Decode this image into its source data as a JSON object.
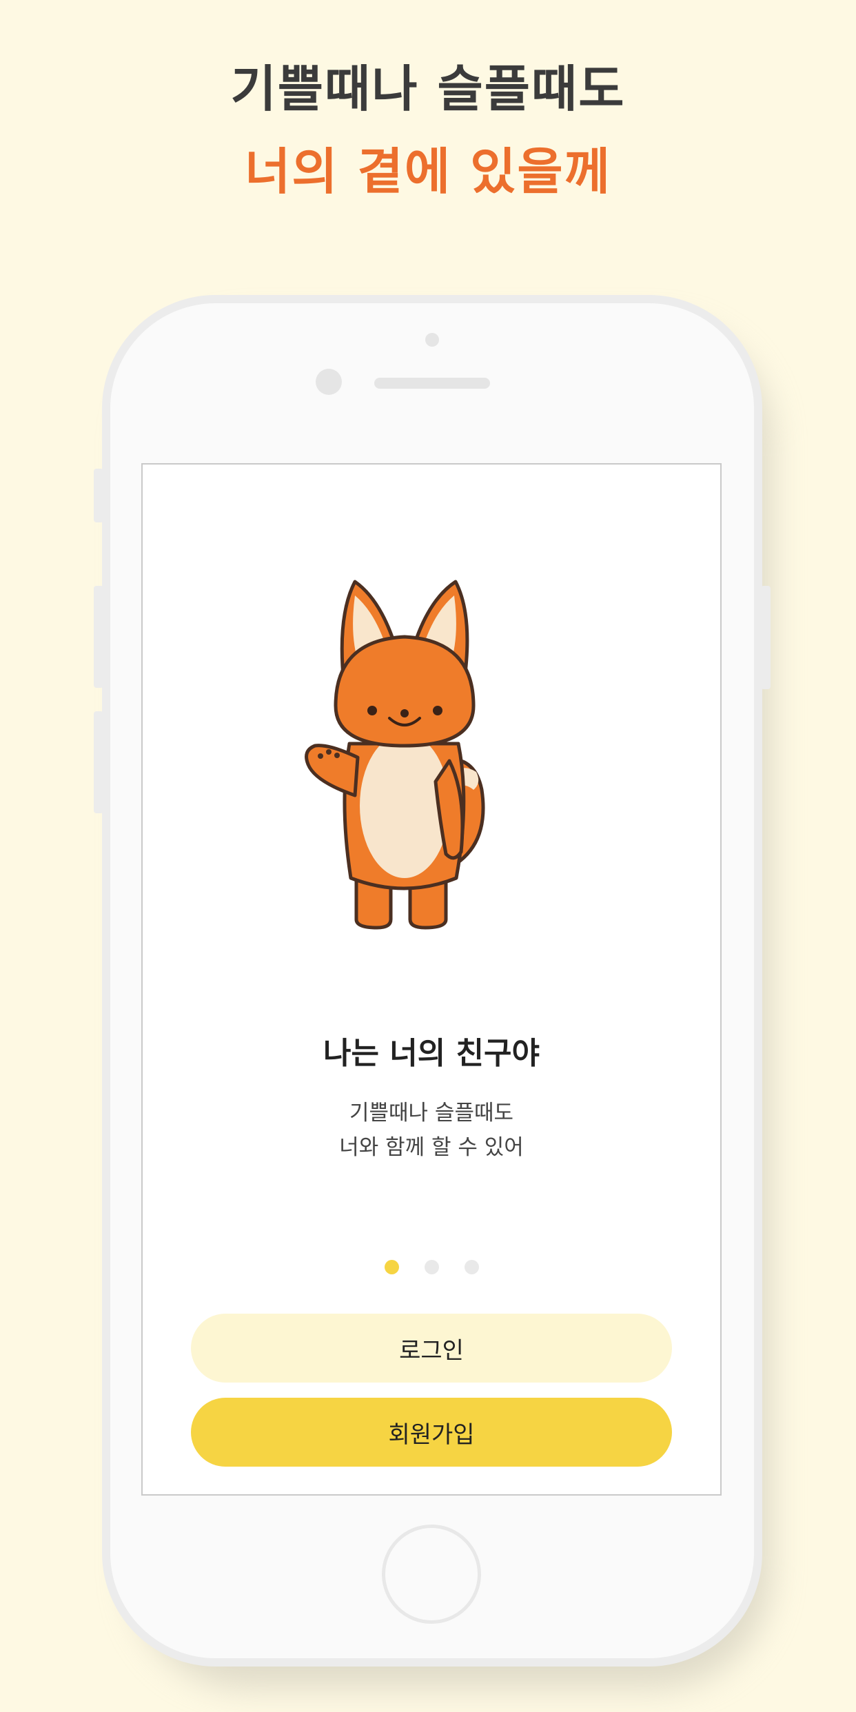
{
  "promo": {
    "line1": "기쁠때나 슬플때도",
    "line2": "너의 곁에 있을께"
  },
  "colors": {
    "background": "#fef9e3",
    "accent_orange": "#ec6f2d",
    "accent_yellow": "#f6d443",
    "login_button": "#fdf6d2"
  },
  "screen": {
    "mascot_icon": "fox-mascot-waving",
    "title": "나는 너의 친구야",
    "subtitle_line1": "기쁠때나 슬플때도",
    "subtitle_line2": "너와 함께 할 수 있어",
    "pagination": {
      "total": 3,
      "active_index": 0
    },
    "login_label": "로그인",
    "signup_label": "회원가입"
  }
}
